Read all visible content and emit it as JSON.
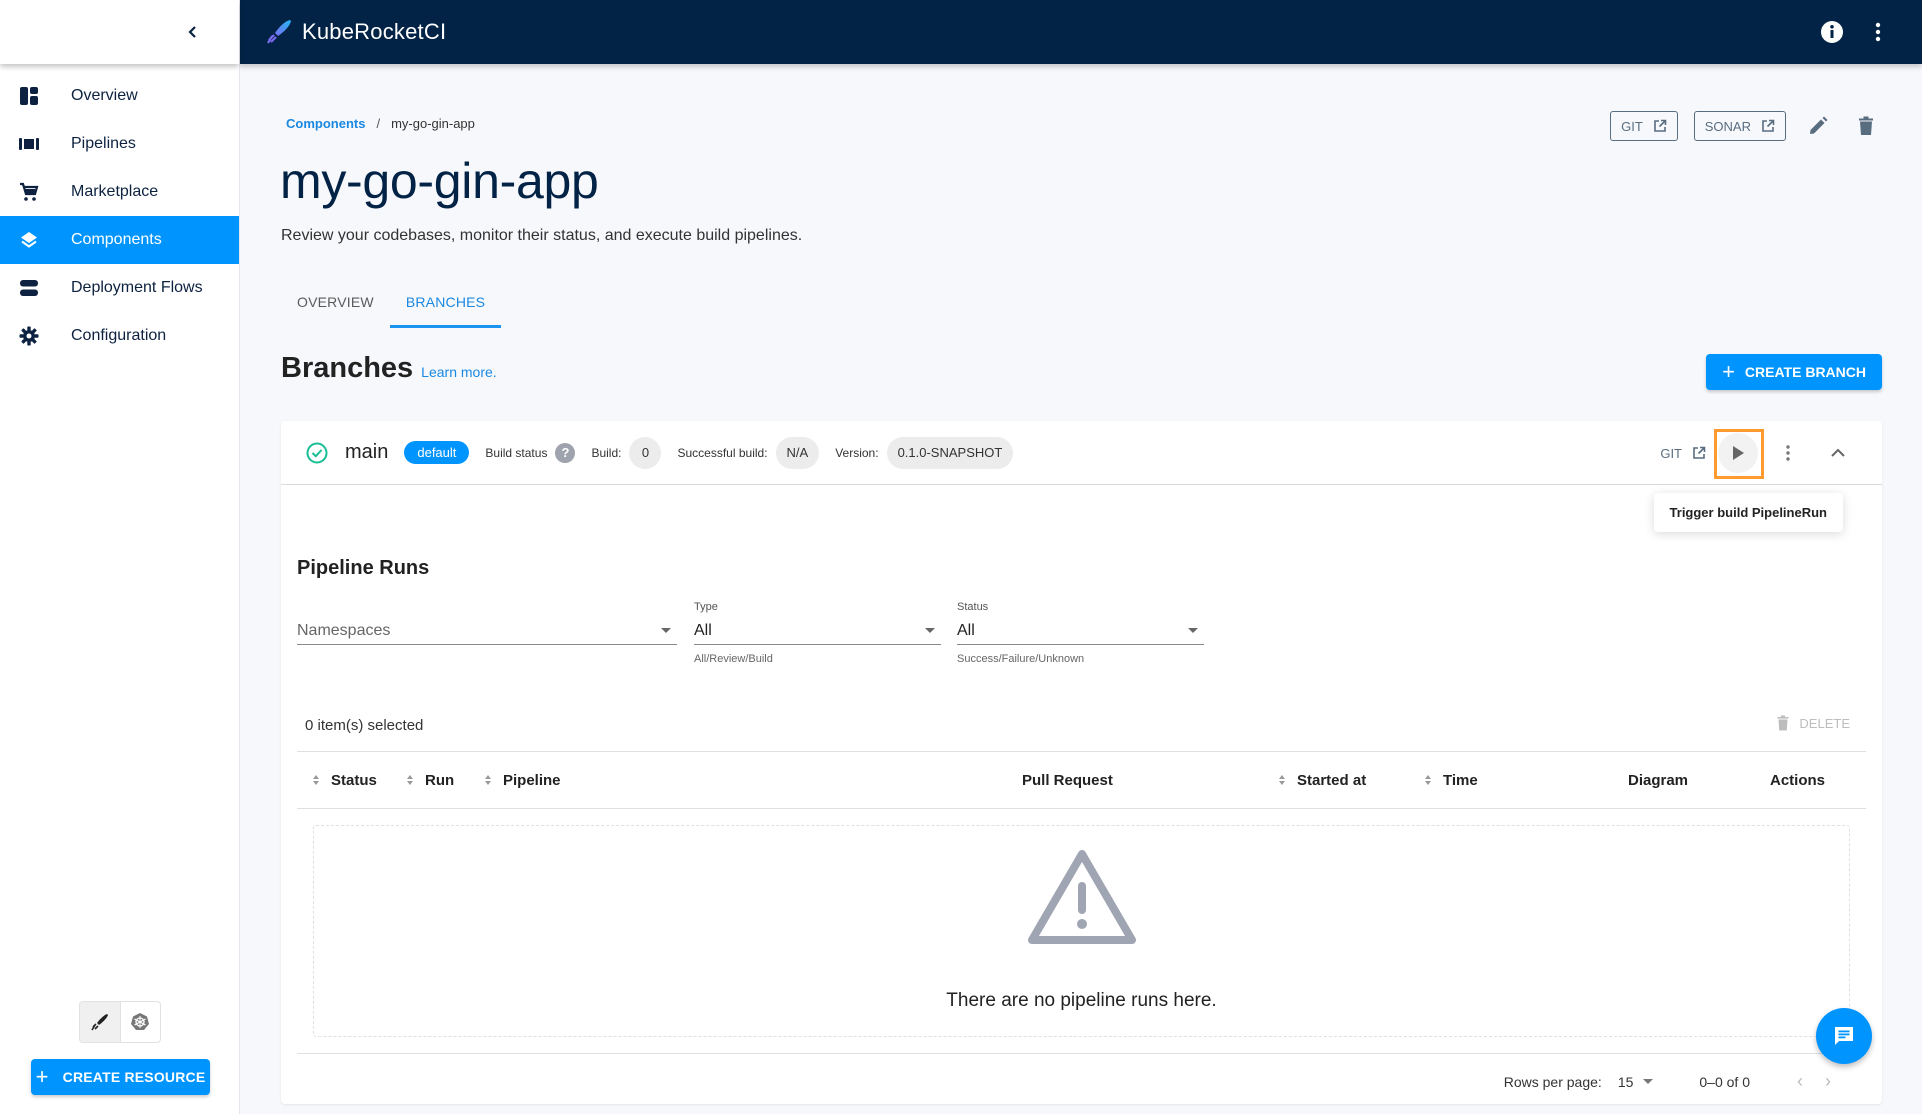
{
  "app": {
    "title": "KubeRocketCI"
  },
  "sidebar": {
    "items": [
      {
        "label": "Overview",
        "icon": "dashboard-icon",
        "active": false
      },
      {
        "label": "Pipelines",
        "icon": "pipelines-icon",
        "active": false
      },
      {
        "label": "Marketplace",
        "icon": "cart-icon",
        "active": false
      },
      {
        "label": "Components",
        "icon": "layers-icon",
        "active": true
      },
      {
        "label": "Deployment Flows",
        "icon": "flows-icon",
        "active": false
      },
      {
        "label": "Configuration",
        "icon": "gear-icon",
        "active": false
      }
    ],
    "create_resource_label": "CREATE RESOURCE"
  },
  "breadcrumb": {
    "parent": "Components",
    "separator": "/",
    "current": "my-go-gin-app"
  },
  "top_actions": {
    "git_label": "GIT",
    "sonar_label": "SONAR"
  },
  "page": {
    "title": "my-go-gin-app",
    "description": "Review your codebases, monitor their status, and execute build pipelines."
  },
  "tabs": [
    {
      "label": "OVERVIEW",
      "active": false
    },
    {
      "label": "BRANCHES",
      "active": true
    }
  ],
  "branches": {
    "title": "Branches",
    "learn_more": "Learn more.",
    "create_label": "CREATE BRANCH"
  },
  "branch": {
    "name": "main",
    "badge": "default",
    "build_status_label": "Build status",
    "build_status_value": "?",
    "build_label": "Build:",
    "build_value": "0",
    "successful_build_label": "Successful build:",
    "successful_build_value": "N/A",
    "version_label": "Version:",
    "version_value": "0.1.0-SNAPSHOT",
    "git_label": "GIT",
    "tooltip": "Trigger build PipelineRun",
    "status_color": "#18be94"
  },
  "pipeline_runs": {
    "title": "Pipeline Runs",
    "filters": {
      "namespaces": {
        "placeholder": "Namespaces"
      },
      "type": {
        "label": "Type",
        "value": "All",
        "helper": "All/Review/Build"
      },
      "status": {
        "label": "Status",
        "value": "All",
        "helper": "Success/Failure/Unknown"
      }
    },
    "selected_text": "0 item(s) selected",
    "delete_label": "DELETE",
    "columns": [
      "Status",
      "Run",
      "Pipeline",
      "Pull Request",
      "Started at",
      "Time",
      "Diagram",
      "Actions"
    ],
    "empty_text": "There are no pipeline runs here.",
    "rows_per_page_label": "Rows per page:",
    "rows_per_page": "15",
    "range_text": "0–0 of 0"
  },
  "colors": {
    "accent": "#0094ff",
    "header": "#022345",
    "highlight": "#ff9a2e"
  }
}
